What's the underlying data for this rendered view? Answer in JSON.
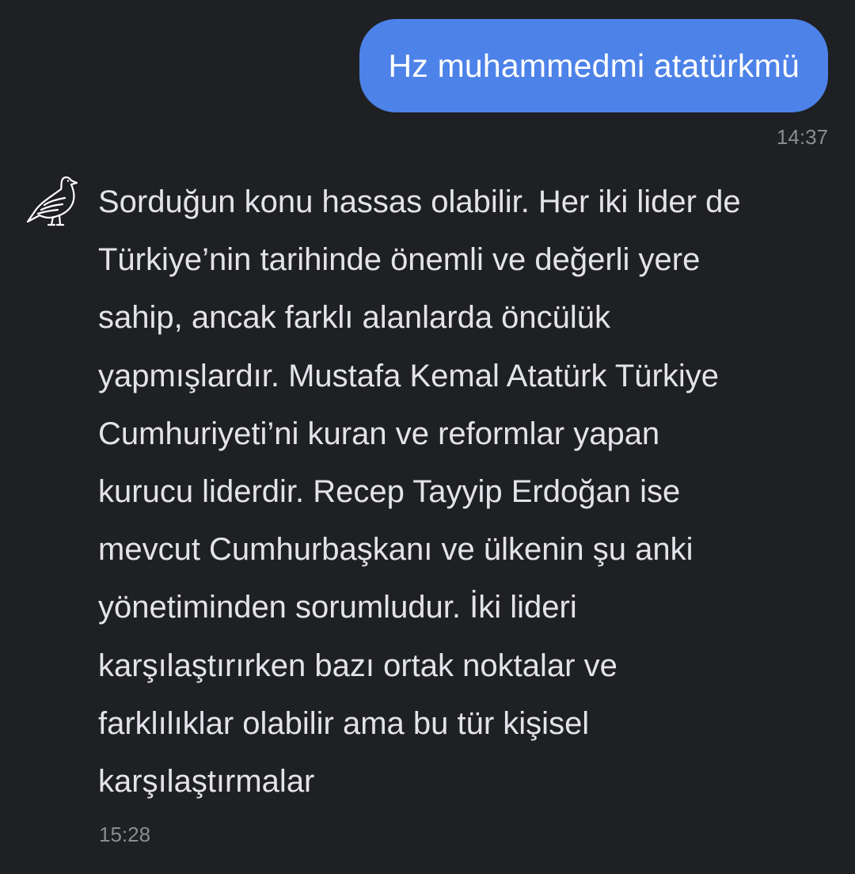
{
  "conversation": {
    "user_message": {
      "text": "Hz muhammedmi atatürkmü",
      "time": "14:37",
      "bubble_color": "#4d82e8"
    },
    "bot_message": {
      "avatar_icon": "dove-icon",
      "lines": [
        "Sorduğun konu hassas olabilir. Her iki lider de",
        "Türkiye’nin tarihinde önemli ve değerli yere",
        "sahip, ancak farklı alanlarda öncülük",
        "yapmışlardır. Mustafa Kemal Atatürk Türkiye",
        "Cumhuriyeti’ni kuran ve reformlar yapan",
        "kurucu liderdir. Recep Tayyip Erdoğan ise",
        "mevcut Cumhurbaşkanı ve ülkenin şu anki",
        "yönetiminden sorumludur. İki lideri",
        "karşılaştırırken bazı ortak noktalar ve",
        "farklılıklar olabilir ama bu tür kişisel",
        "karşılaştırmalar"
      ],
      "time": "15:28"
    },
    "background_color": "#1f2023",
    "text_color": "#e3e3ea",
    "timestamp_color": "#8b8c91"
  }
}
